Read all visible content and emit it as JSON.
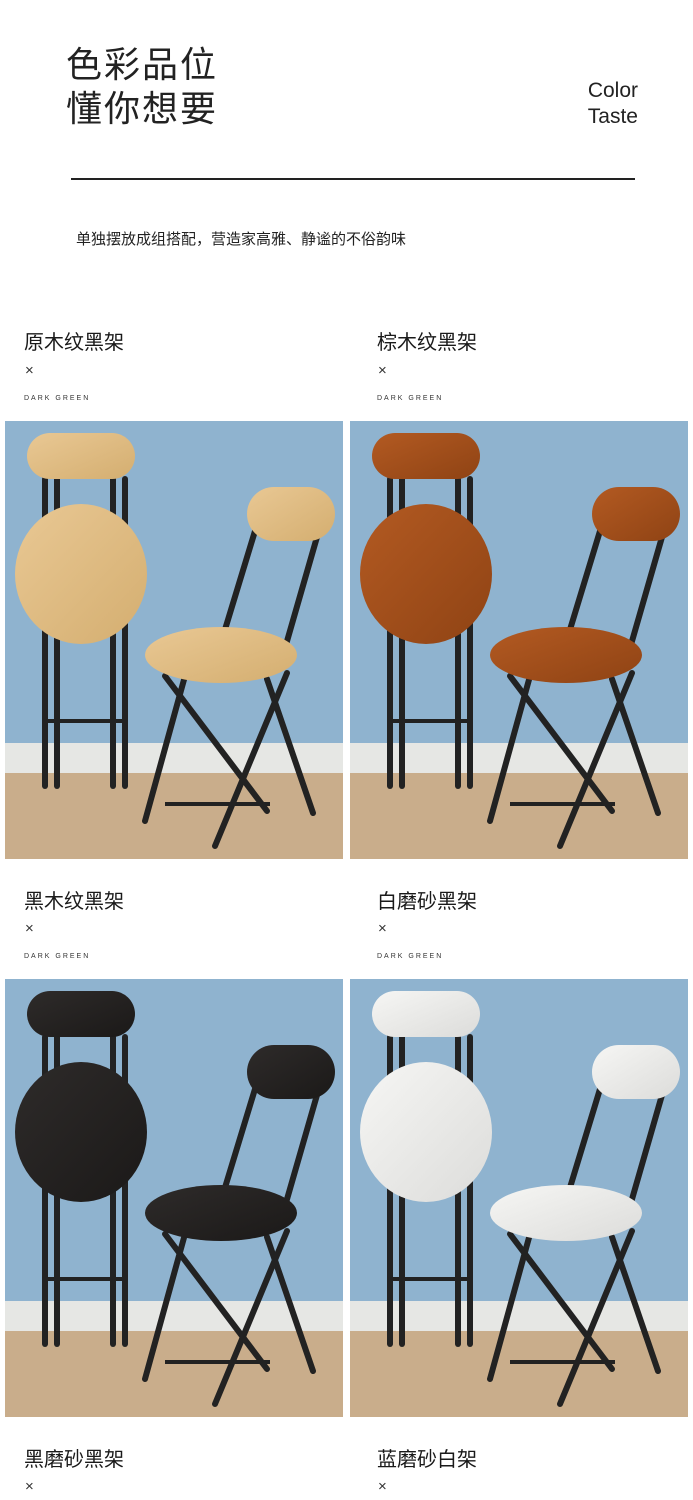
{
  "hero": {
    "title_line1": "色彩品位",
    "title_line2": "懂你想要",
    "en_line1": "Color",
    "en_line2": "Taste"
  },
  "subtitle": "单独摆放成组搭配，营造家高雅、静谧的不俗韵味",
  "cells": [
    {
      "label": "原木纹黑架",
      "x_mark": "×",
      "sub": "DARK GREEN",
      "wood": "#e9c894",
      "wood_dark": "#d4ae70",
      "frame": "#222222"
    },
    {
      "label": "棕木纹黑架",
      "x_mark": "×",
      "sub": "DARK GREEN",
      "wood": "#b35a22",
      "wood_dark": "#8f4314",
      "frame": "#222222"
    },
    {
      "label": "黑木纹黑架",
      "x_mark": "×",
      "sub": "DARK GREEN",
      "wood": "#2e2b2a",
      "wood_dark": "#1b1918",
      "frame": "#222222"
    },
    {
      "label": "白磨砂黑架",
      "x_mark": "×",
      "sub": "DARK GREEN",
      "wood": "#f6f6f4",
      "wood_dark": "#dcdcda",
      "frame": "#222222"
    },
    {
      "label": "黑磨砂黑架",
      "x_mark": "×"
    },
    {
      "label": "蓝磨砂白架",
      "x_mark": "×"
    }
  ],
  "colors": {
    "wall": "#8fb3cf",
    "baseboard": "#e6e7e4",
    "floor": "#c9ad8b"
  }
}
